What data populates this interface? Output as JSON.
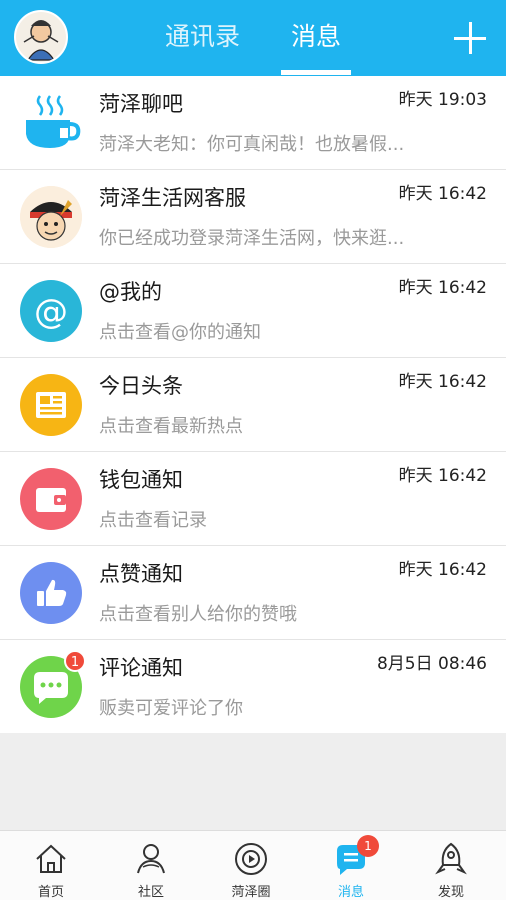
{
  "header": {
    "tabs": [
      {
        "label": "通讯录"
      },
      {
        "label": "消息"
      }
    ],
    "active_tab": "消息",
    "colors": {
      "bar": "#1fb4ef"
    }
  },
  "messages": [
    {
      "title": "菏泽聊吧",
      "time": "昨天 19:03",
      "preview": "菏泽大老知：你可真闲哉！也放暑假...",
      "icon": "coffee-cup-icon"
    },
    {
      "title": "菏泽生活网客服",
      "time": "昨天 16:42",
      "preview": "你已经成功登录菏泽生活网，快来逛...",
      "icon": "avatar"
    },
    {
      "title": "@我的",
      "time": "昨天 16:42",
      "preview": "点击查看@你的通知",
      "icon": "at-sign-icon"
    },
    {
      "title": "今日头条",
      "time": "昨天 16:42",
      "preview": "点击查看最新热点",
      "icon": "newspaper-icon"
    },
    {
      "title": "钱包通知",
      "time": "昨天 16:42",
      "preview": "点击查看记录",
      "icon": "wallet-icon"
    },
    {
      "title": "点赞通知",
      "time": "昨天 16:42",
      "preview": "点击查看别人给你的赞哦",
      "icon": "thumbs-up-icon"
    },
    {
      "title": "评论通知",
      "time": "8月5日 08:46",
      "preview": "贩卖可爱评论了你",
      "icon": "comment-icon",
      "badge": "1"
    }
  ],
  "bottom_nav": [
    {
      "label": "首页",
      "icon": "home-icon"
    },
    {
      "label": "社区",
      "icon": "community-icon"
    },
    {
      "label": "菏泽圈",
      "icon": "circle-icon"
    },
    {
      "label": "消息",
      "icon": "message-icon",
      "badge": "1",
      "active": true
    },
    {
      "label": "发现",
      "icon": "rocket-icon"
    }
  ]
}
